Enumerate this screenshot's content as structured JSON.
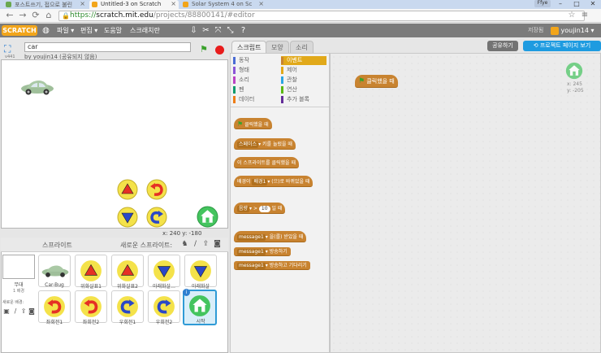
{
  "browser": {
    "tabs": [
      {
        "title": "포스트쓰기, 접으로 불린",
        "color": "#6aa84f"
      },
      {
        "title": "Untitled-3 on Scratch",
        "color": "#f2a51a"
      },
      {
        "title": "Solar System 4 on Sc",
        "color": "#f2a51a"
      }
    ],
    "user_chip": "Ffye",
    "url_prefix": "https://",
    "url_host": "scratch.mit.edu",
    "url_path": "/projects/88800141/#editor"
  },
  "menubar": {
    "logo": "SCRATCH",
    "items": [
      "파일",
      "편집",
      "도움말",
      "스크래치란"
    ],
    "save_status": "저장됨",
    "user": "youjin14"
  },
  "stage": {
    "version": "v441",
    "project_name": "car",
    "byline": "by youjin14 (공유되지 않음)",
    "coords": "x: 240  y: -180"
  },
  "sprites": {
    "title": "스프라이트",
    "new_sprite": "새로운 스프라이트:",
    "stage_label": "무대",
    "stage_sub": "1 배경",
    "backdrop_label": "새로운 배경:",
    "items": [
      {
        "name": "Car-Bug",
        "icon": "car",
        "color": "#8fb08a"
      },
      {
        "name": "위화살표1",
        "icon": "up-arrow",
        "color": "#e53025"
      },
      {
        "name": "위화살표2",
        "icon": "up-arrow",
        "color": "#e53025"
      },
      {
        "name": "아래화살…",
        "icon": "down-arrow",
        "color": "#2a48c8"
      },
      {
        "name": "아래화살",
        "icon": "down-arrow",
        "color": "#2a48c8"
      },
      {
        "name": "좌회전1",
        "icon": "turn-left",
        "color": "#e53025"
      },
      {
        "name": "좌회전2",
        "icon": "turn-left",
        "color": "#e53025"
      },
      {
        "name": "우회전1",
        "icon": "turn-right",
        "color": "#2a48c8"
      },
      {
        "name": "우회전2",
        "icon": "turn-right",
        "color": "#2a48c8"
      },
      {
        "name": "시작",
        "icon": "home",
        "color": "#44c45e"
      }
    ]
  },
  "tabs": {
    "scripts": "스크립트",
    "costumes": "모양",
    "sounds": "소리",
    "share": "공유하기",
    "project_page": "프로젝트 페이지 보기"
  },
  "categories": {
    "left": [
      {
        "label": "동작",
        "color": "#4a6cd4"
      },
      {
        "label": "형태",
        "color": "#8a55d7"
      },
      {
        "label": "소리",
        "color": "#bb42c3"
      },
      {
        "label": "펜",
        "color": "#0e9a6c"
      },
      {
        "label": "데이터",
        "color": "#ee7d16"
      }
    ],
    "right": [
      {
        "label": "이벤트",
        "color": "#c88330",
        "active": true
      },
      {
        "label": "제어",
        "color": "#e1a91a"
      },
      {
        "label": "관찰",
        "color": "#2ca5e2"
      },
      {
        "label": "연산",
        "color": "#5cb712"
      },
      {
        "label": "추가 블록",
        "color": "#632d99"
      }
    ]
  },
  "blocks": {
    "flag_clicked": "클릭했을 때",
    "key_pressed_key": "스페이스",
    "key_pressed": "키를 눌렀을 때",
    "sprite_clicked": "이 스프라이트를 클릭했을 때",
    "backdrop_prefix": "배경이",
    "backdrop_value": "배경1",
    "backdrop_suffix": "(으)로 바뀌었을 때",
    "sensor_field": "음량",
    "sensor_op": ">",
    "sensor_value": "10",
    "sensor_suffix": "일 때",
    "msg_field": "message1",
    "msg_received": "을(를) 받았을 때",
    "broadcast": "방송하기",
    "broadcast_wait": "방송하고 기다리기"
  },
  "scripts_area": {
    "hat_label": "클릭했을 때",
    "x": "x: 245",
    "y": "y: -205"
  }
}
